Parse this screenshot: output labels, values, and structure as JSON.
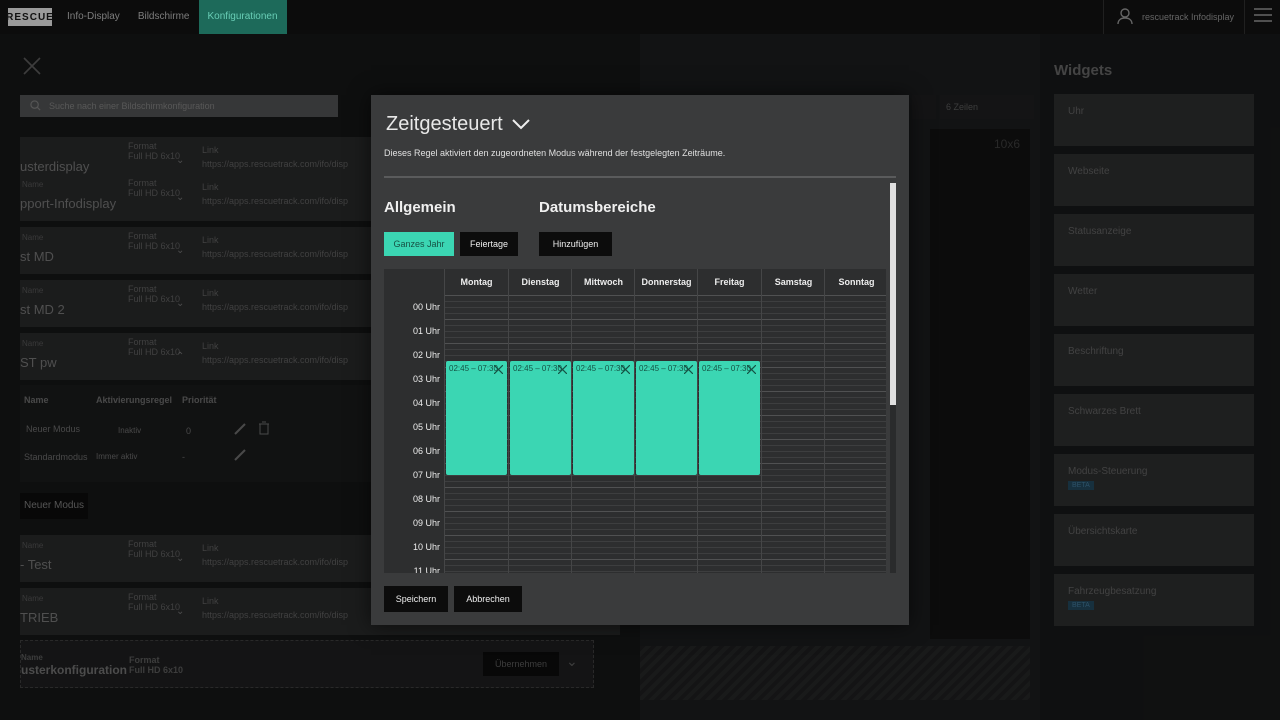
{
  "topbar": {
    "logo": "RESCUE",
    "nav": [
      "Info-Display",
      "Bildschirme",
      "Konfigurationen"
    ],
    "active_nav": 2,
    "user": "rescuetrack Infodisplay"
  },
  "left": {
    "search_placeholder": "Suche nach einer Bildschirmkonfiguration",
    "rows": [
      {
        "label": "Name",
        "name": "usterdisplay",
        "format_label": "Format",
        "format": "Full HD 6x10",
        "link_label": "Link",
        "url": "https://apps.rescuetrack.com/ifo/disp"
      },
      {
        "label": "Name",
        "name": "pport-Infodisplay",
        "format_label": "Format",
        "format": "Full HD 6x10",
        "link_label": "Link",
        "url": "https://apps.rescuetrack.com/ifo/disp"
      },
      {
        "label": "Name",
        "name": "st MD",
        "format_label": "Format",
        "format": "Full HD 6x10",
        "link_label": "Link",
        "url": "https://apps.rescuetrack.com/ifo/disp"
      },
      {
        "label": "Name",
        "name": "st MD 2",
        "format_label": "Format",
        "format": "Full HD 6x10",
        "link_label": "Link",
        "url": "https://apps.rescuetrack.com/ifo/disp"
      },
      {
        "label": "Name",
        "name": "ST pw",
        "format_label": "Format",
        "format": "Full HD 6x10",
        "link_label": "Link",
        "url": "https://apps.rescuetrack.com/ifo/disp"
      }
    ],
    "mode_headers": [
      "Name",
      "Aktivierungsregel",
      "Priorität"
    ],
    "modes": [
      {
        "name": "Neuer Modus",
        "rule": "Inaktiv",
        "prio": "0"
      },
      {
        "name": "Standardmodus",
        "rule": "Immer aktiv",
        "prio": "-"
      }
    ],
    "new_mode_btn": "Neuer Modus",
    "rows2": [
      {
        "label": "Name",
        "name": "- Test",
        "format_label": "Format",
        "format": "Full HD 6x10",
        "link_label": "Link",
        "url": "https://apps.rescuetrack.com/ifo/disp"
      },
      {
        "label": "Name",
        "name": "TRIEB",
        "format_label": "Format",
        "format": "Full HD 6x10",
        "link_label": "Link",
        "url": "https://apps.rescuetrack.com/ifo/disp"
      }
    ],
    "template": {
      "label": "Name",
      "name": "usterkonfiguration",
      "format_label": "Format",
      "format": "Full HD 6x10",
      "apply_btn": "Übernehmen"
    }
  },
  "editor": {
    "rows_label": "6 Zeilen",
    "grid_label": "10x6"
  },
  "widgets": {
    "title": "Widgets",
    "items": [
      {
        "label": "Uhr",
        "beta": ""
      },
      {
        "label": "Webseite",
        "beta": ""
      },
      {
        "label": "Statusanzeige",
        "beta": ""
      },
      {
        "label": "Wetter",
        "beta": ""
      },
      {
        "label": "Beschriftung",
        "beta": ""
      },
      {
        "label": "Schwarzes Brett",
        "beta": ""
      },
      {
        "label": "Modus-Steuerung",
        "beta": "BETA"
      },
      {
        "label": "Übersichtskarte",
        "beta": ""
      },
      {
        "label": "Fahrzeugbesatzung",
        "beta": "BETA"
      }
    ]
  },
  "modal": {
    "title": "Zeitgesteuert",
    "description": "Dieses Regel aktiviert den zugeordneten Modus während der festgelegten Zeiträume.",
    "section_general": "Allgemein",
    "section_dates": "Datumsbereiche",
    "btn_whole_year": "Ganzes Jahr",
    "btn_holidays": "Feiertage",
    "btn_add": "Hinzufügen",
    "days": [
      "Montag",
      "Dienstag",
      "Mittwoch",
      "Donnerstag",
      "Freitag",
      "Samstag",
      "Sonntag"
    ],
    "hours": [
      "00 Uhr",
      "01 Uhr",
      "02 Uhr",
      "03 Uhr",
      "04 Uhr",
      "05 Uhr",
      "06 Uhr",
      "07 Uhr",
      "08 Uhr",
      "09 Uhr",
      "10 Uhr",
      "11 Uhr"
    ],
    "events": [
      {
        "day": 0,
        "start": 2.75,
        "end": 7.5,
        "label": "02:45 – 07:30"
      },
      {
        "day": 1,
        "start": 2.75,
        "end": 7.5,
        "label": "02:45 – 07:30"
      },
      {
        "day": 2,
        "start": 2.75,
        "end": 7.5,
        "label": "02:45 – 07:30"
      },
      {
        "day": 3,
        "start": 2.75,
        "end": 7.5,
        "label": "02:45 – 07:30"
      },
      {
        "day": 4,
        "start": 2.75,
        "end": 7.5,
        "label": "02:45 – 07:30"
      }
    ],
    "btn_save": "Speichern",
    "btn_cancel": "Abbrechen"
  },
  "colors": {
    "accent": "#3bd6b3",
    "modal_bg": "#3a3b3c",
    "nav_active": "#1d6a5a"
  }
}
